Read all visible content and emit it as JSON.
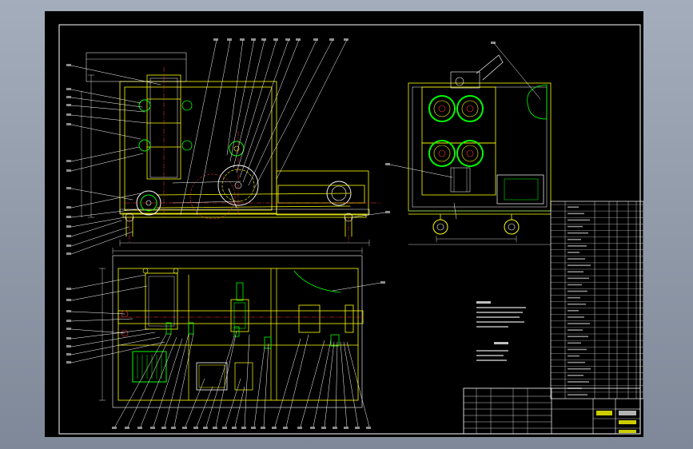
{
  "colors": {
    "background": "#8f99a8",
    "sheet": "#000000",
    "frame": "#ffffff",
    "outline": "#ffff00",
    "gear": "#00ff00",
    "leader": "#ffffff",
    "hidden": "#ff3b3b",
    "center": "#ff3b3b",
    "hatch": "#00c8ff"
  },
  "title_block": {
    "company": "",
    "drawing_no": "",
    "sheet": ""
  },
  "parts_list": {
    "rows": 30
  },
  "notes": {
    "technical_requirements": [],
    "technical_specs": []
  }
}
